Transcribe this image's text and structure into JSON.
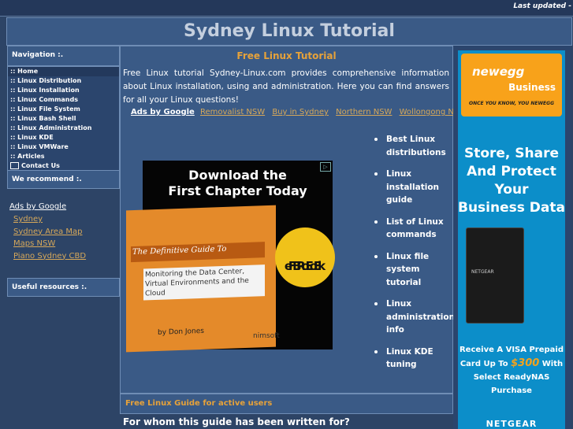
{
  "topbar": {
    "last_updated": "Last updated -"
  },
  "header": {
    "title": "Sydney Linux Tutorial"
  },
  "sidebar": {
    "navigation_title": "Navigation :.",
    "items": [
      {
        "label": ":: Home"
      },
      {
        "label": ":: Linux Distribution"
      },
      {
        "label": ":: Linux Installation"
      },
      {
        "label": ":: Linux Commands"
      },
      {
        "label": ":: Linux File System"
      },
      {
        "label": ":: Linux Bash Shell"
      },
      {
        "label": ":: Linux Administration"
      },
      {
        "label": ":: Linux KDE"
      },
      {
        "label": ":: Linux VMWare"
      },
      {
        "label": ":: Articles"
      },
      {
        "label": "Contact Us"
      }
    ],
    "recommend_title": "We recommend :.",
    "ads_title": "Ads by Google",
    "ads_links": [
      "Sydney",
      "Sydney Area Map",
      "Maps NSW",
      "Piano Sydney CBD"
    ],
    "useful_title": "Useful resources :."
  },
  "main": {
    "title": "Free Linux Tutorial",
    "intro": "Free Linux tutorial Sydney-Linux.com provides comprehensive information about Linux installation, using and administration. Here you can find answers for all your Linux questions!",
    "ads_title": "Ads by Google",
    "ads_links": [
      "Removalist NSW",
      "Buy in Sydney",
      "Northern NSW",
      "Wollongong NSW"
    ],
    "banner": {
      "headline_1": "Download the",
      "headline_2": "First Chapter Today",
      "book_title": "The Definitive Guide To",
      "book_subtitle": "Monitoring the Data Center, Virtual Environments and the Cloud",
      "author": "by Don Jones",
      "free_1": "FREE",
      "free_2": "eBook",
      "publisher": "nimsoft"
    },
    "topics": [
      "Best Linux distributions",
      "Linux installation guide",
      "List of Linux commands",
      "Linux file system tutorial",
      "Linux administration info",
      "Linux KDE tuning"
    ],
    "guide_title": "Free Linux Guide for active users",
    "bottom_question": "For whom this guide has been written for?"
  },
  "right_ad": {
    "brand": "newegg",
    "brand_sub": "Business",
    "slogan": "ONCE YOU KNOW, YOU NEWEGG",
    "headline_1": "Store, Share",
    "headline_2": "And Protect Your",
    "headline_3": "Business Data",
    "device_label": "NETGEAR",
    "offer_1": "Receive A VISA Prepaid",
    "offer_2": "Card Up To",
    "offer_price": "$300",
    "offer_3": "With",
    "offer_4": "Select ReadyNAS Purchase",
    "footer_brand": "NETGEAR"
  }
}
